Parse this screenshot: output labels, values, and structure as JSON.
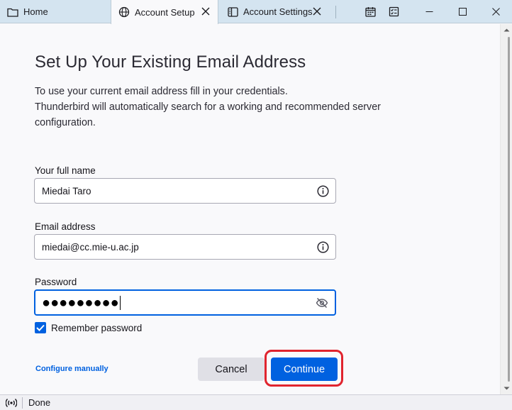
{
  "tabs": [
    {
      "label": "Home",
      "icon": "folder-icon"
    },
    {
      "label": "Account Setup",
      "icon": "globe-icon",
      "active": true
    },
    {
      "label": "Account Settings",
      "icon": "sidebar-layout-icon"
    }
  ],
  "toolbar_icons": [
    "calendar-icon",
    "tasks-icon"
  ],
  "window_controls": [
    "minimize",
    "maximize",
    "close"
  ],
  "page": {
    "title": "Set Up Your Existing Email Address",
    "description_line1": "To use your current email address fill in your credentials.",
    "description_line2": "Thunderbird will automatically search for a working and recommended server configuration."
  },
  "form": {
    "full_name_label": "Your full name",
    "full_name_value": "Miedai Taro",
    "email_label": "Email address",
    "email_value": "miedai@cc.mie-u.ac.jp",
    "password_label": "Password",
    "password_masked": "●●●●●●●●●",
    "remember_label": "Remember password",
    "remember_checked": true
  },
  "actions": {
    "configure_manually": "Configure manually",
    "cancel": "Cancel",
    "continue": "Continue"
  },
  "status": {
    "text": "Done"
  },
  "colors": {
    "accent": "#0061e0",
    "highlight": "#e0242e",
    "tabbar": "#d4e4f0"
  }
}
